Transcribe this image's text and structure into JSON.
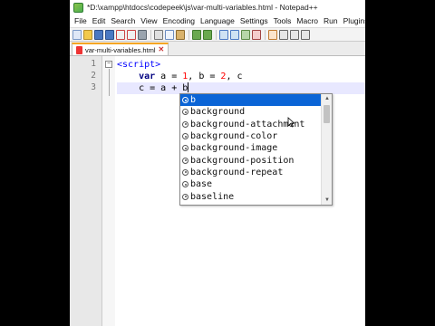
{
  "window": {
    "title": "*D:\\xampp\\htdocs\\codepeek\\js\\var-multi-variables.html - Notepad++"
  },
  "menu": [
    "File",
    "Edit",
    "Search",
    "View",
    "Encoding",
    "Language",
    "Settings",
    "Tools",
    "Macro",
    "Run",
    "Plugins"
  ],
  "toolbar": {
    "buttons": [
      "new-file-icon",
      "open-icon",
      "save-icon",
      "save-all-icon",
      "close-icon",
      "close-all-icon",
      "print-icon",
      "cut-icon",
      "copy-icon",
      "paste-icon",
      "undo-icon",
      "redo-icon",
      "find-icon",
      "replace-icon",
      "zoom-in-icon",
      "zoom-out-icon",
      "sync-icon",
      "wrap-icon",
      "show-all-icon",
      "indent-guide-icon"
    ]
  },
  "tab": {
    "label": "var-multi-variables.html",
    "close_symbol": "✕"
  },
  "editor": {
    "line_numbers": [
      "1",
      "2",
      "3"
    ],
    "fold_symbol": "−",
    "lines": [
      {
        "tokens": [
          {
            "t": "<script>",
            "c": "tag"
          }
        ]
      },
      {
        "tokens": [
          {
            "t": "    ",
            "c": "plain"
          },
          {
            "t": "var",
            "c": "kw"
          },
          {
            "t": " a = ",
            "c": "plain"
          },
          {
            "t": "1",
            "c": "num"
          },
          {
            "t": ", b = ",
            "c": "plain"
          },
          {
            "t": "2",
            "c": "num"
          },
          {
            "t": ", c",
            "c": "plain"
          }
        ]
      },
      {
        "tokens": [
          {
            "t": "    c = a + b",
            "c": "plain"
          }
        ]
      }
    ]
  },
  "autocomplete": {
    "selected_index": 0,
    "items": [
      "b",
      "background",
      "background-attachment",
      "background-color",
      "background-image",
      "background-position",
      "background-repeat",
      "base",
      "baseline"
    ]
  },
  "colors": {
    "selection": "#0a64d6",
    "current_line": "#e8e8ff",
    "tab_accent": "#f5a623"
  }
}
